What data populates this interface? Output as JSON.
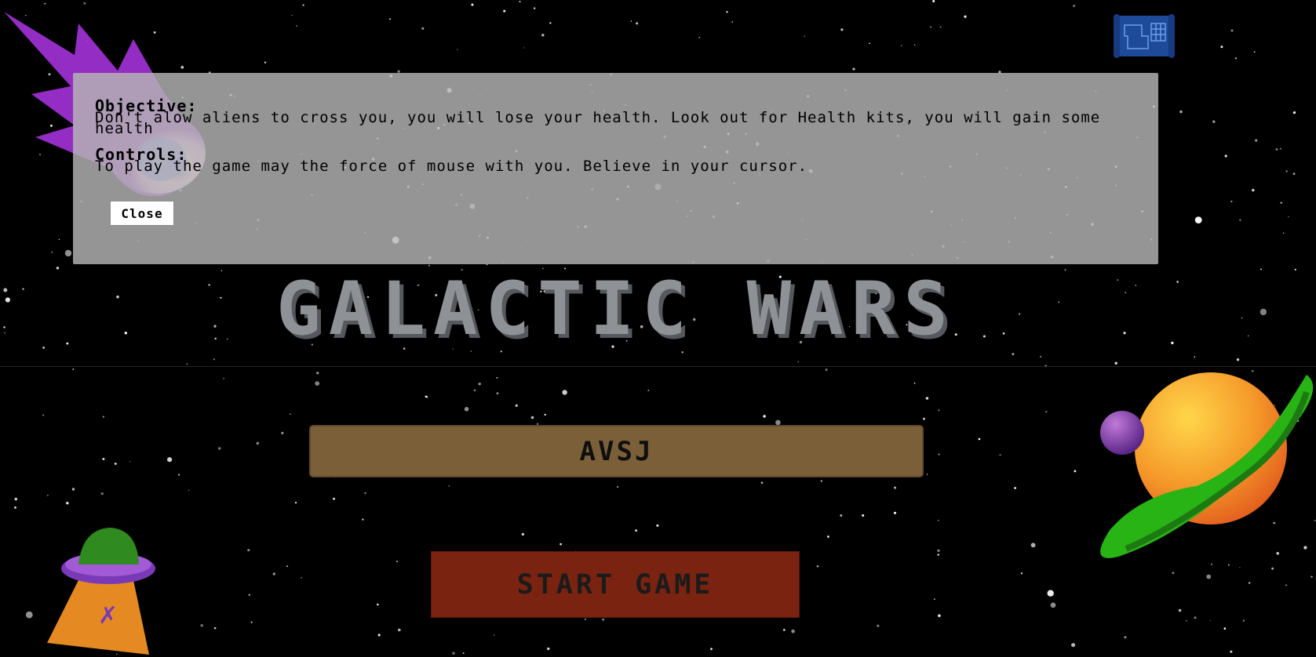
{
  "modal": {
    "objective_heading": "Objective:",
    "objective_text": "Don't alow aliens to cross you, you will lose your health. Look out for Health kits, you will gain some health",
    "controls_heading": "Controls:",
    "controls_text": "To play the game may the force of mouse with you. Believe in your cursor.",
    "close_label": "Close"
  },
  "game": {
    "title": "GALACTIC WARS",
    "player_name": "AVSJ",
    "start_label": "START GAME"
  },
  "icons": {
    "top_right": "blueprint-icon",
    "comet": "comet-icon",
    "planet": "planet-icon",
    "ufo": "ufo-icon"
  },
  "colors": {
    "background": "#000000",
    "title": "#8e9196",
    "name_field": "#7a5f38",
    "start_button": "#7a2310",
    "modal": "#b6b6b6"
  }
}
